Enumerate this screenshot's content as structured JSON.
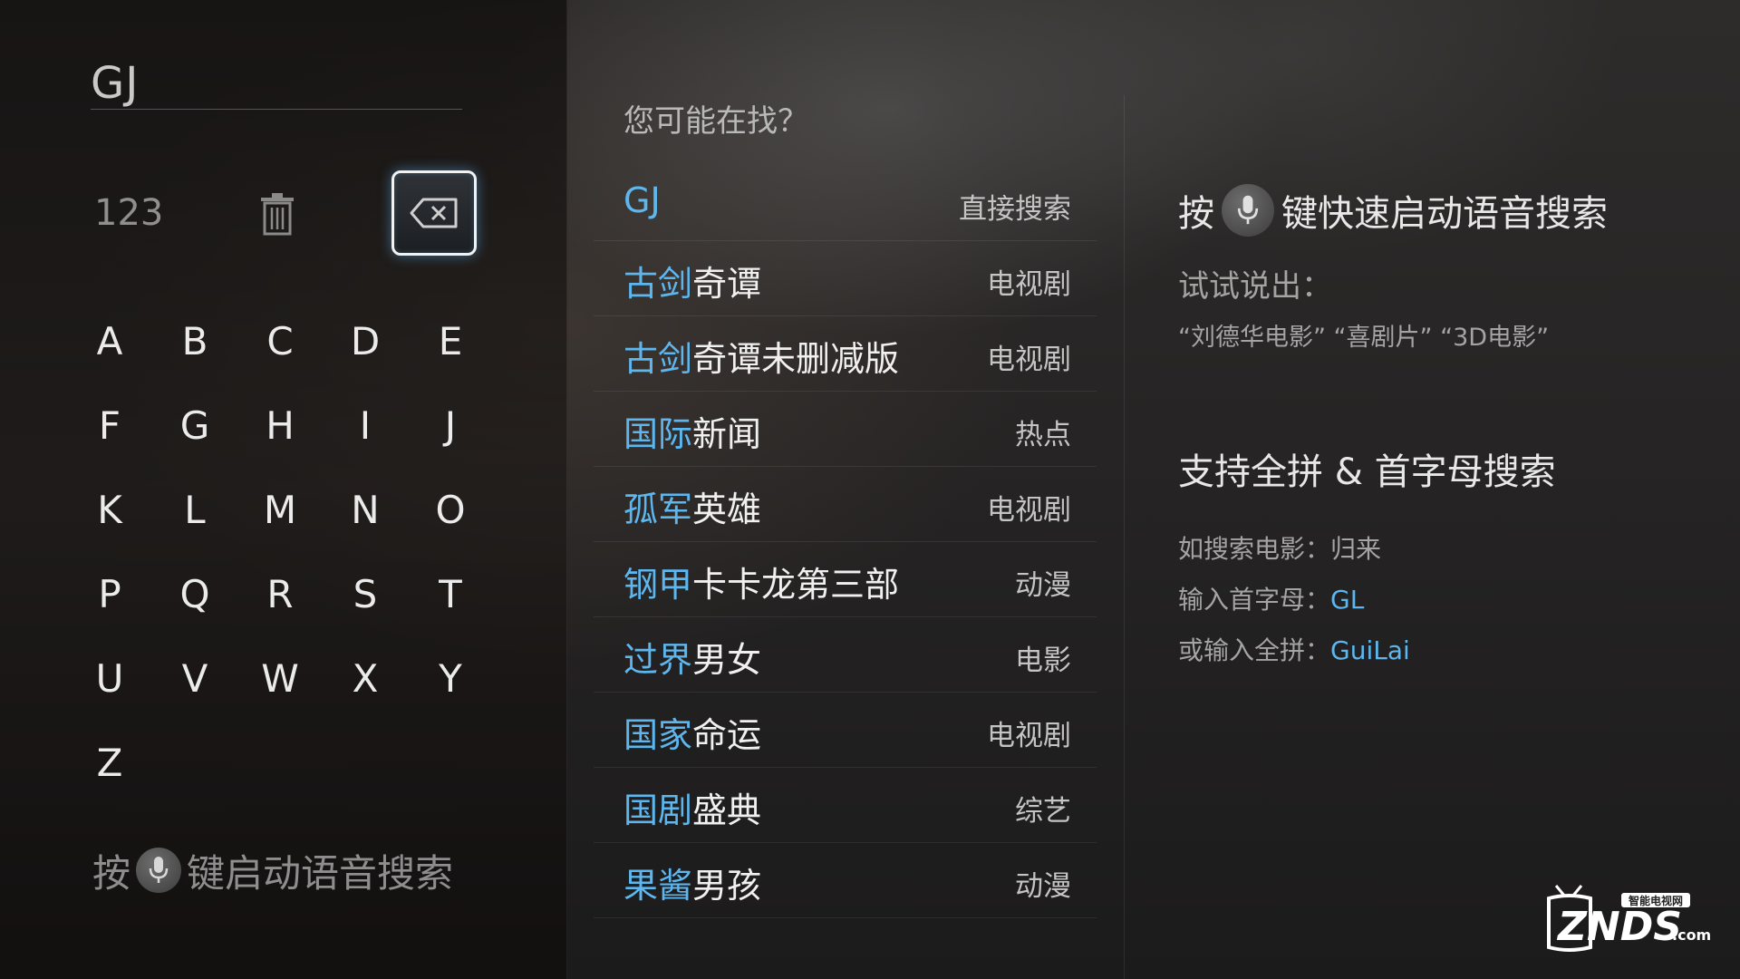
{
  "search": {
    "query": "GJ",
    "num_key_label": "123",
    "letters": [
      "A",
      "B",
      "C",
      "D",
      "E",
      "F",
      "G",
      "H",
      "I",
      "J",
      "K",
      "L",
      "M",
      "N",
      "O",
      "P",
      "Q",
      "R",
      "S",
      "T",
      "U",
      "V",
      "W",
      "X",
      "Y",
      "Z"
    ],
    "hint_prefix": "按",
    "hint_suffix": "键启动语音搜索"
  },
  "suggestions": {
    "title": "您可能在找？",
    "items": [
      {
        "highlight": "GJ",
        "rest": "",
        "category": "直接搜索"
      },
      {
        "highlight": "古剑",
        "rest": "奇谭",
        "category": "电视剧"
      },
      {
        "highlight": "古剑",
        "rest": "奇谭未删减版",
        "category": "电视剧"
      },
      {
        "highlight": "国际",
        "rest": "新闻",
        "category": "热点"
      },
      {
        "highlight": "孤军",
        "rest": "英雄",
        "category": "电视剧"
      },
      {
        "highlight": "钢甲",
        "rest": "卡卡龙第三部",
        "category": "动漫"
      },
      {
        "highlight": "过界",
        "rest": "男女",
        "category": "电影"
      },
      {
        "highlight": "国家",
        "rest": "命运",
        "category": "电视剧"
      },
      {
        "highlight": "国剧",
        "rest": "盛典",
        "category": "综艺"
      },
      {
        "highlight": "果酱",
        "rest": "男孩",
        "category": "动漫"
      }
    ]
  },
  "info": {
    "voice_prefix": "按",
    "voice_suffix": "键快速启动语音搜索",
    "try_label": "试试说出：",
    "try_examples": "“刘德华电影” “喜剧片” “3D电影”",
    "pinyin_heading": "支持全拼 & 首字母搜索",
    "example_label": "如搜索电影：归来",
    "initials_label": "输入首字母：",
    "initials_value": "GL",
    "full_label": "或输入全拼：",
    "full_value": "GuiLai"
  },
  "watermark": {
    "top_text": "智能电视网",
    "main_text": "ZNDS",
    "suffix": ".com"
  },
  "colors": {
    "highlight": "#5db7ee",
    "focus_border": "#f2f2f2"
  }
}
